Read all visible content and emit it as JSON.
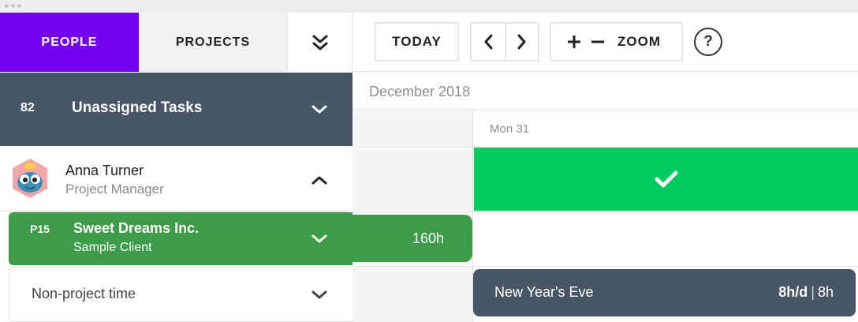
{
  "tabs": {
    "people": "PEOPLE",
    "projects": "PROJECTS",
    "collapse_icon": "double-chevron-down"
  },
  "toolbar": {
    "today": "TODAY",
    "prev_icon": "chevron-left",
    "next_icon": "chevron-right",
    "zoom_in_icon": "plus",
    "zoom_out_icon": "minus",
    "zoom_label": "ZOOM",
    "help": "?"
  },
  "unassigned": {
    "count": "82",
    "title": "Unassigned Tasks"
  },
  "person": {
    "name": "Anna Turner",
    "role": "Project Manager"
  },
  "project": {
    "code": "P15",
    "name": "Sweet Dreams Inc.",
    "client": "Sample Client",
    "hours": "160h"
  },
  "nonproject": {
    "label": "Non-project time"
  },
  "calendar": {
    "month": "December 2018",
    "day": "Mon 31"
  },
  "holiday": {
    "name": "New Year's Eve",
    "rate": "8h/d",
    "separator": "|",
    "total": "8h"
  },
  "colors": {
    "people_tab": "#7300f0",
    "unassigned_bg": "#475767",
    "project_green": "#3d9c47",
    "available_green": "#00cc5e"
  }
}
